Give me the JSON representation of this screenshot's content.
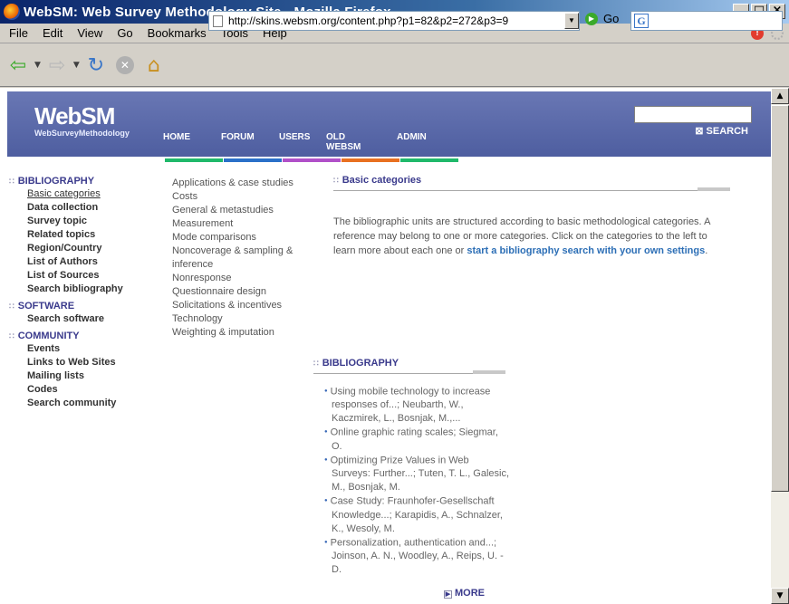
{
  "window": {
    "title": "WebSM: Web Survey Methodology Site - Mozilla Firefox"
  },
  "menu": [
    "File",
    "Edit",
    "View",
    "Go",
    "Bookmarks",
    "Tools",
    "Help"
  ],
  "toolbar": {
    "url": "http://skins.websm.org/content.php?p1=82&p2=272&p3=9",
    "go_label": "Go",
    "search_engine_glyph": "G"
  },
  "site": {
    "logo_text": "WebSM",
    "logo_subtitle": "WebSurveyMethodology",
    "nav": [
      "HOME",
      "FORUM",
      "USERS",
      "OLD\nWEBSM",
      "ADMIN"
    ],
    "search_label": "SEARCH",
    "color_bars": [
      "#1fb96a",
      "#2a70c8",
      "#b050c8",
      "#e87020",
      "#1fb96a"
    ]
  },
  "leftnav": {
    "sections": [
      {
        "title": "BIBLIOGRAPHY",
        "items": [
          "Basic categories",
          "Data collection",
          "Survey topic",
          "Related topics",
          "Region/Country",
          "List of Authors",
          "List of Sources",
          "Search bibliography"
        ]
      },
      {
        "title": "SOFTWARE",
        "items": [
          "Search software"
        ]
      },
      {
        "title": "COMMUNITY",
        "items": [
          "Events",
          "Links to Web Sites",
          "Mailing lists",
          "Codes",
          "Search community"
        ]
      }
    ],
    "active_item": "Basic categories"
  },
  "categories": [
    "Applications & case studies",
    "Costs",
    "General & metastudies",
    "Measurement",
    "Mode comparisons",
    "Noncoverage & sampling & inference",
    "Nonresponse",
    "Questionnaire design",
    "Solicitations & incentives",
    "Technology",
    "Weighting & imputation"
  ],
  "main": {
    "heading": "Basic categories",
    "intro_text": "The bibliographic units are structured according to basic methodological categories. A reference may belong to one or more categories. Click on the categories to the left to learn more about each one or ",
    "intro_link": "start a bibliography search with your own settings",
    "intro_end": "."
  },
  "bibliography": {
    "heading": "BIBLIOGRAPHY",
    "items": [
      "Using mobile technology to increase responses of...; Neubarth, W., Kaczmirek, L., Bosnjak, M.,...",
      "Online graphic rating scales; Siegmar, O.",
      "Optimizing Prize Values in Web Surveys: Further...; Tuten, T. L., Galesic, M., Bosnjak, M.",
      "Case Study: Fraunhofer-Gesellschaft Knowledge...; Karapidis, A., Schnalzer, K., Wesoly, M.",
      "Personalization, authentication and...; Joinson, A. N., Woodley, A., Reips, U. -D."
    ],
    "more_label": "MORE"
  }
}
